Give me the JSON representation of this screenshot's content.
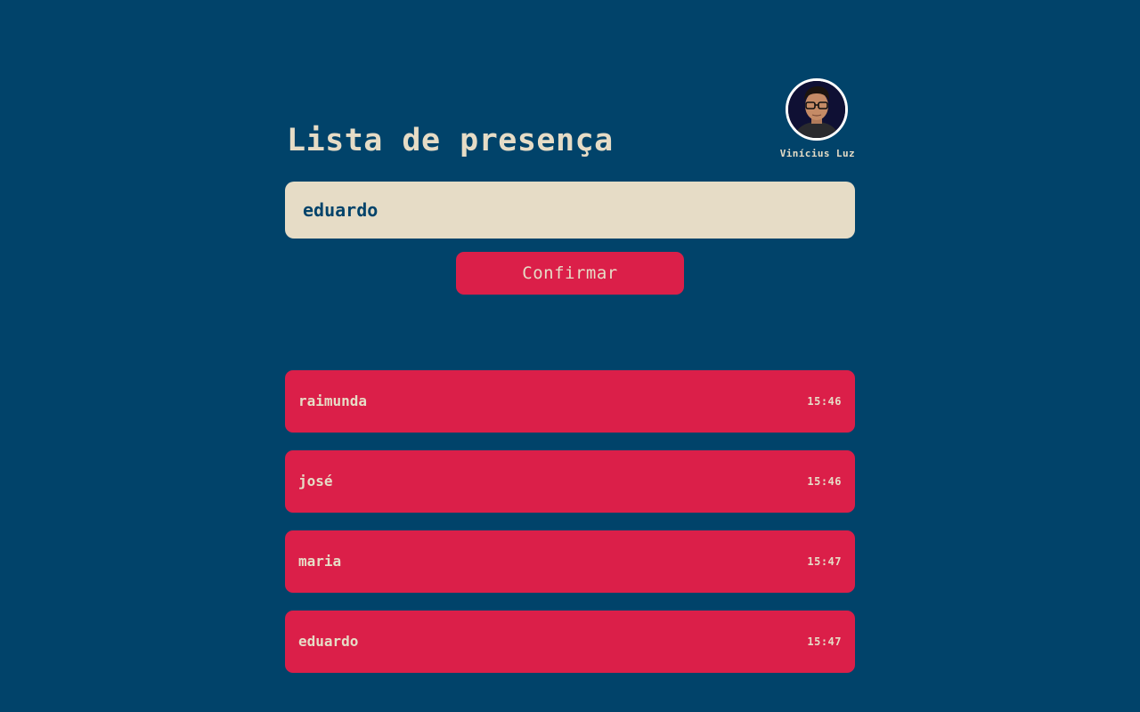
{
  "header": {
    "title": "Lista de presença",
    "profile": {
      "name": "Vinícius Luz",
      "avatar_icon": "user-photo"
    }
  },
  "form": {
    "input_value": "eduardo",
    "input_placeholder": "",
    "confirm_label": "Confirmar"
  },
  "attendance": [
    {
      "name": "raimunda",
      "time": "15:46"
    },
    {
      "name": "josé",
      "time": "15:46"
    },
    {
      "name": "maria",
      "time": "15:47"
    },
    {
      "name": "eduardo",
      "time": "15:47"
    }
  ],
  "colors": {
    "background": "#01436a",
    "accent": "#db1f49",
    "cream": "#e6dcc6"
  }
}
